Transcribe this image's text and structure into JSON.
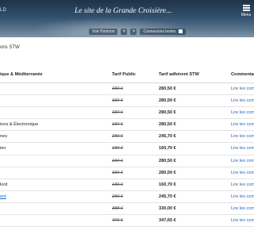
{
  "header": {
    "logo_text": "LD",
    "title": "Le site de la Grande Croisière...",
    "menu_label": "Menu"
  },
  "controls": {
    "horizon_label": "Voir l'horizon",
    "prev_arrow": "<",
    "next_arrow": ">",
    "slow_connection_label": "Connexions lentes"
  },
  "breadcrumb": "ons STW",
  "table": {
    "columns": [
      "ique & Méditerranée",
      "Tarif Public",
      "Tarif adhérent STW",
      "Commenta"
    ],
    "rows": [
      {
        "name": "",
        "public": "330 €",
        "member": "280,50 €",
        "comment": "Lire les com"
      },
      {
        "name": "",
        "public": "330 €",
        "member": "280,50 €",
        "comment": "Lire les com"
      },
      {
        "name": "",
        "public": "330 €",
        "member": "280,50 €",
        "comment": "Lire les com"
      },
      {
        "name": "ions & Électronique",
        "public": "330 €",
        "member": "280,50 €",
        "comment": "Lire les com"
      },
      {
        "name": "nes",
        "public": "289 €",
        "member": "245,70 €",
        "comment": "Lire les com"
      },
      {
        "name": "ien",
        "public": "189 €",
        "member": "160,70 €",
        "comment": "Lire les com"
      },
      {
        "name": "",
        "public": "330 €",
        "member": "280,50 €",
        "comment": "Lire les com"
      },
      {
        "name": "",
        "public": "330 €",
        "member": "280,50 €",
        "comment": "Lire les com"
      },
      {
        "name": "lord",
        "public": "189 €",
        "member": "160,70 €",
        "comment": "Lire les com"
      },
      {
        "name": "ent",
        "public": "289 €",
        "member": "245,70 €",
        "comment": "Lire les com",
        "link": true
      },
      {
        "name": "",
        "public": "388 €",
        "member": "330,00 €",
        "comment": "Lire les com"
      },
      {
        "name": "",
        "public": "409 €",
        "member": "347,65 €",
        "comment": "Lire les com"
      }
    ]
  },
  "colors": {
    "link": "#1e67b6",
    "banner_dark": "#1f3347"
  },
  "icons": {
    "menu": "hamburger-icon",
    "prev": "chevron-left-icon",
    "next": "chevron-right-icon",
    "checkbox": "checkbox-icon"
  }
}
